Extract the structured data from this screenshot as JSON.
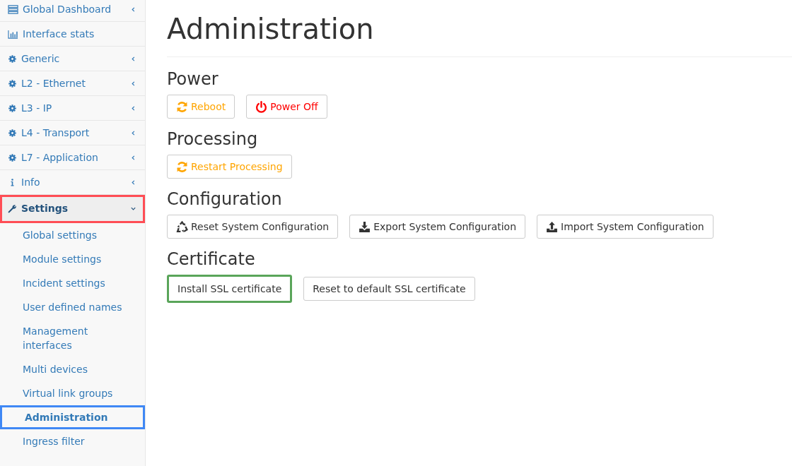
{
  "sidebar": {
    "items": [
      {
        "label": "Global Dashboard",
        "kind": "dashboard",
        "expandable": true,
        "expanded": false,
        "highlighted": false
      },
      {
        "label": "Interface stats",
        "kind": "chart",
        "expandable": false,
        "expanded": false,
        "highlighted": false
      },
      {
        "label": "Generic",
        "kind": "gear",
        "expandable": true,
        "expanded": false,
        "highlighted": false
      },
      {
        "label": "L2 - Ethernet",
        "kind": "gear",
        "expandable": true,
        "expanded": false,
        "highlighted": false
      },
      {
        "label": "L3 - IP",
        "kind": "gear",
        "expandable": true,
        "expanded": false,
        "highlighted": false
      },
      {
        "label": "L4 - Transport",
        "kind": "gear",
        "expandable": true,
        "expanded": false,
        "highlighted": false
      },
      {
        "label": "L7 - Application",
        "kind": "gear",
        "expandable": true,
        "expanded": false,
        "highlighted": false
      },
      {
        "label": "Info",
        "kind": "info",
        "expandable": true,
        "expanded": false,
        "highlighted": false
      },
      {
        "label": "Settings",
        "kind": "wrench",
        "expandable": true,
        "expanded": true,
        "highlighted": true,
        "children": [
          {
            "label": "Global settings",
            "selected": false,
            "highlighted": false
          },
          {
            "label": "Module settings",
            "selected": false,
            "highlighted": false
          },
          {
            "label": "Incident settings",
            "selected": false,
            "highlighted": false
          },
          {
            "label": "User defined names",
            "selected": false,
            "highlighted": false
          },
          {
            "label": "Management interfaces",
            "selected": false,
            "highlighted": false
          },
          {
            "label": "Multi devices",
            "selected": false,
            "highlighted": false
          },
          {
            "label": "Virtual link groups",
            "selected": false,
            "highlighted": false
          },
          {
            "label": "Administration",
            "selected": true,
            "highlighted": true
          },
          {
            "label": "Ingress filter",
            "selected": false,
            "highlighted": false
          }
        ]
      }
    ]
  },
  "page": {
    "title": "Administration",
    "sections": [
      {
        "title": "Power",
        "buttons": [
          {
            "label": "Reboot",
            "kind": "refresh",
            "color": "#ffa500",
            "highlighted": false
          },
          {
            "label": "Power Off",
            "kind": "power",
            "color": "#ff0000",
            "highlighted": false
          }
        ]
      },
      {
        "title": "Processing",
        "buttons": [
          {
            "label": "Restart Processing",
            "kind": "refresh",
            "color": "#ffa500",
            "highlighted": false
          }
        ]
      },
      {
        "title": "Configuration",
        "buttons": [
          {
            "label": "Reset System Configuration",
            "kind": "recycle",
            "highlighted": false
          },
          {
            "label": "Export System Configuration",
            "kind": "download",
            "highlighted": false
          },
          {
            "label": "Import System Configuration",
            "kind": "upload",
            "highlighted": false
          }
        ]
      },
      {
        "title": "Certificate",
        "buttons": [
          {
            "label": "Install SSL certificate",
            "kind": "plain",
            "highlighted": true
          },
          {
            "label": "Reset to default SSL certificate",
            "kind": "plain",
            "highlighted": false
          }
        ]
      }
    ]
  }
}
